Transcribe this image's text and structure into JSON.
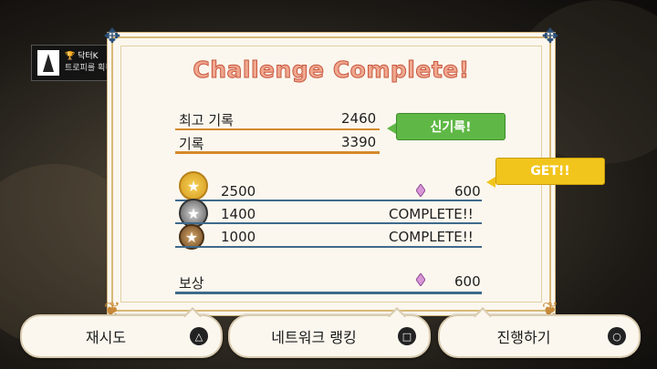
{
  "toast": {
    "title": "🏆 닥터K",
    "message": "트로피를 획득했습니다!",
    "icon": "playstation-icon"
  },
  "panel": {
    "title": "Challenge Complete!",
    "records": [
      {
        "label": "최고 기록",
        "value": "2460"
      },
      {
        "label": "기록",
        "value": "3390"
      }
    ],
    "new_record_badge": "신기록!",
    "get_badge": "GET!!",
    "medals": [
      {
        "icon": "gold-medal-icon",
        "score": "2500",
        "reward": "600"
      },
      {
        "icon": "silver-medal-icon",
        "score": "1400",
        "status": "COMPLETE!!"
      },
      {
        "icon": "bronze-medal-icon",
        "score": "1000",
        "status": "COMPLETE!!"
      }
    ],
    "reward": {
      "label": "보상",
      "value": "600",
      "icon": "gem-icon"
    }
  },
  "buttons": {
    "retry": {
      "label": "재시도",
      "icon": "triangle-icon"
    },
    "ranking": {
      "label": "네트워크 랭킹",
      "icon": "square-icon"
    },
    "proceed": {
      "label": "진행하기",
      "icon": "circle-icon"
    }
  },
  "colors": {
    "title": "#f0a78f",
    "green_badge": "#5fb845",
    "yellow_badge": "#f2c51c",
    "orange_line": "#d48a2a",
    "blue_line": "#3f6a8c"
  }
}
